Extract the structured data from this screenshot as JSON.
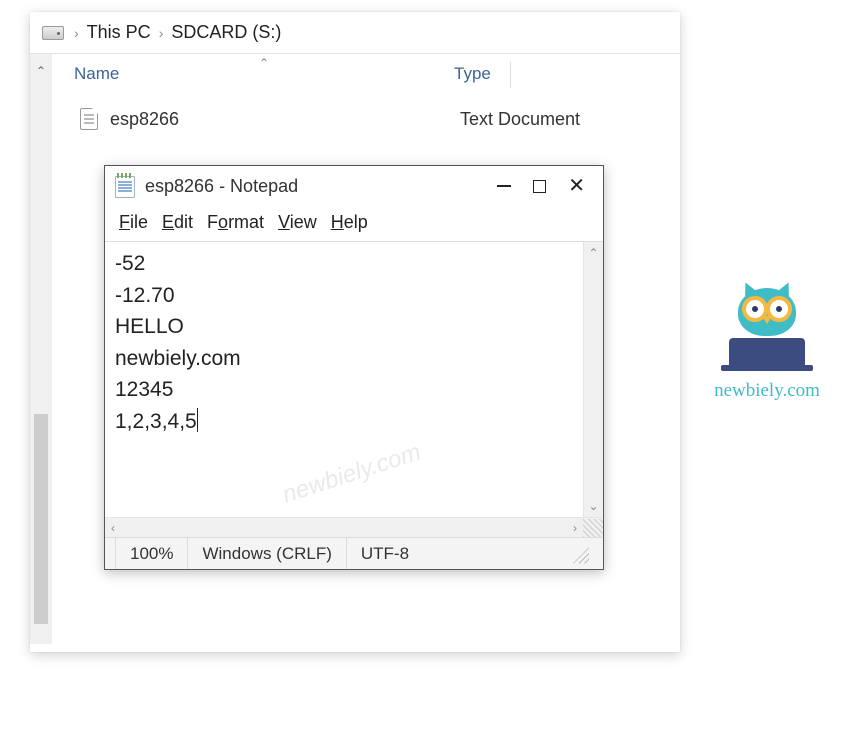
{
  "explorer": {
    "breadcrumbs": [
      "This PC",
      "SDCARD (S:)"
    ],
    "columns": {
      "name": "Name",
      "type": "Type"
    },
    "files": [
      {
        "name": "esp8266",
        "type": "Text Document"
      }
    ]
  },
  "notepad": {
    "title": "esp8266 - Notepad",
    "menu": {
      "file": "File",
      "edit": "Edit",
      "format": "Format",
      "view": "View",
      "help": "Help"
    },
    "lines": [
      "-52",
      "-12.70",
      "HELLO",
      "newbiely.com",
      "12345",
      "1,2,3,4,5"
    ],
    "status": {
      "zoom": "100%",
      "lineending": "Windows (CRLF)",
      "encoding": "UTF-8"
    }
  },
  "watermark": "newbiely.com",
  "logo": {
    "text": "newbiely.com"
  }
}
